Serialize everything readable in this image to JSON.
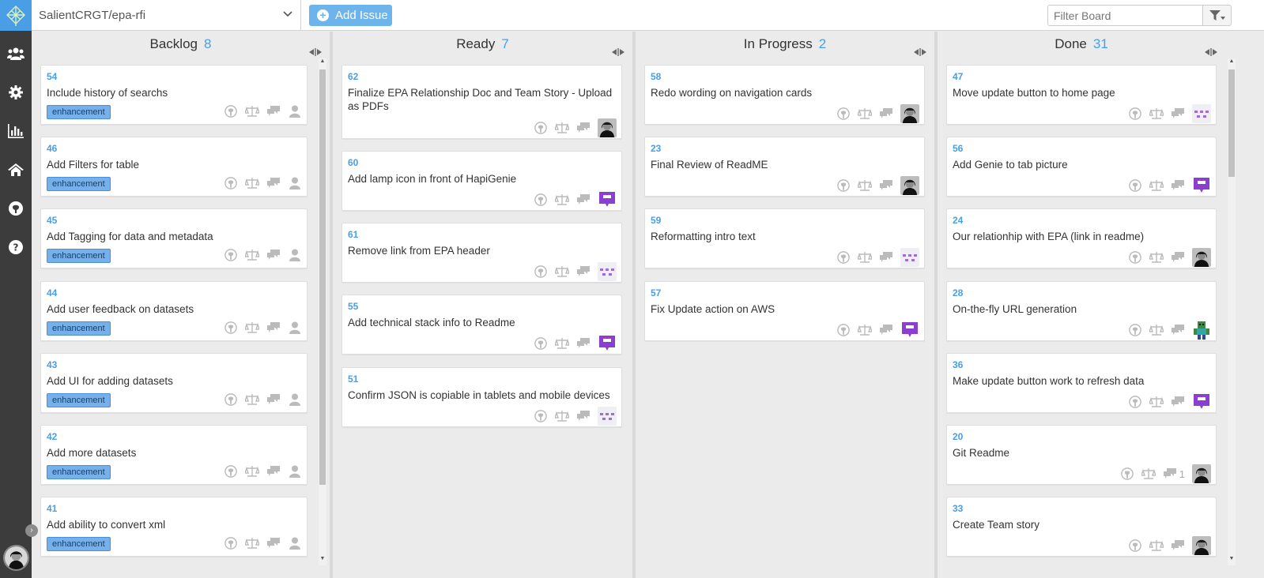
{
  "repo": {
    "name": "SalientCRGT/epa-rfi"
  },
  "toolbar": {
    "add_issue_label": "Add Issue",
    "filter_placeholder": "Filter Board"
  },
  "colors": {
    "accent": "#4a9ee5",
    "label_bg": "#75b0ea",
    "rail_bg": "#3c3c3c",
    "purple_avatar": "#8a3fd1"
  },
  "rail": {
    "icons": [
      "team-icon",
      "gear-icon",
      "chart-icon",
      "home-icon",
      "github-icon",
      "help-icon"
    ]
  },
  "columns": [
    {
      "name": "Backlog",
      "count": "8",
      "cards": [
        {
          "number": "54",
          "title": "Include history of searchs",
          "label": "enhancement",
          "avatar": "none"
        },
        {
          "number": "46",
          "title": "Add Filters for table",
          "label": "enhancement",
          "avatar": "none"
        },
        {
          "number": "45",
          "title": "Add Tagging for data and metadata",
          "label": "enhancement",
          "avatar": "none"
        },
        {
          "number": "44",
          "title": "Add user feedback on datasets",
          "label": "enhancement",
          "avatar": "none"
        },
        {
          "number": "43",
          "title": "Add UI for adding datasets",
          "label": "enhancement",
          "avatar": "none"
        },
        {
          "number": "42",
          "title": "Add more datasets",
          "label": "enhancement",
          "avatar": "none"
        },
        {
          "number": "41",
          "title": "Add ability to convert xml",
          "label": "enhancement",
          "avatar": "none"
        }
      ]
    },
    {
      "name": "Ready",
      "count": "7",
      "cards": [
        {
          "number": "62",
          "title": "Finalize EPA Relationship Doc and Team Story - Upload as PDFs",
          "label": "",
          "avatar": "photo"
        },
        {
          "number": "60",
          "title": "Add lamp icon in front of HapiGenie",
          "label": "",
          "avatar": "purple"
        },
        {
          "number": "61",
          "title": "Remove link from EPA header",
          "label": "",
          "avatar": "purple-light"
        },
        {
          "number": "55",
          "title": "Add technical stack info to Readme",
          "label": "",
          "avatar": "purple"
        },
        {
          "number": "51",
          "title": "Confirm JSON is copiable in tablets and mobile devices",
          "label": "",
          "avatar": "purple-light"
        }
      ]
    },
    {
      "name": "In Progress",
      "count": "2",
      "cards": [
        {
          "number": "58",
          "title": "Redo wording on navigation cards",
          "label": "",
          "avatar": "photo"
        },
        {
          "number": "23",
          "title": "Final Review of ReadME",
          "label": "",
          "avatar": "photo"
        },
        {
          "number": "59",
          "title": "Reformatting intro text",
          "label": "",
          "avatar": "purple-light"
        },
        {
          "number": "57",
          "title": "Fix Update action on AWS",
          "label": "",
          "avatar": "purple"
        }
      ]
    },
    {
      "name": "Done",
      "count": "31",
      "cards": [
        {
          "number": "47",
          "title": "Move update button to home page",
          "label": "",
          "avatar": "purple-light"
        },
        {
          "number": "56",
          "title": "Add Genie to tab picture",
          "label": "",
          "avatar": "purple"
        },
        {
          "number": "24",
          "title": "Our relationhip with EPA (link in readme)",
          "label": "",
          "avatar": "photo"
        },
        {
          "number": "28",
          "title": "On-the-fly URL generation",
          "label": "",
          "avatar": "green"
        },
        {
          "number": "36",
          "title": "Make update button work to refresh data",
          "label": "",
          "avatar": "purple"
        },
        {
          "number": "20",
          "title": "Git Readme",
          "label": "",
          "avatar": "photo",
          "comments": "1"
        },
        {
          "number": "33",
          "title": "Create Team story",
          "label": "",
          "avatar": "photo"
        }
      ]
    }
  ]
}
